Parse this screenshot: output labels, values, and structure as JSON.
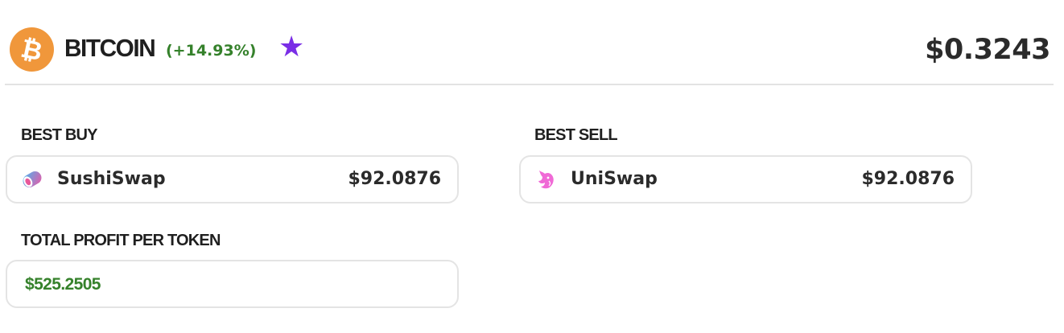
{
  "coin": {
    "icon": "bitcoin-icon",
    "symbol_glyph": "₿",
    "name": "BITCOIN",
    "change": "(+14.93%)",
    "favorite_icon": "star-icon",
    "price": "$0.3243"
  },
  "best_buy": {
    "label": "BEST BUY",
    "exchange": "SushiSwap",
    "exchange_icon": "sushiswap-icon",
    "price": "$92.0876"
  },
  "best_sell": {
    "label": "BEST SELL",
    "exchange": "UniSwap",
    "exchange_icon": "uniswap-icon",
    "price": "$92.0876"
  },
  "profit": {
    "label": "TOTAL PROFIT PER TOKEN",
    "value": "$525.2505"
  },
  "colors": {
    "bitcoin_orange": "#f0973b",
    "positive_green": "#35812b",
    "star_purple": "#7a2ee6",
    "border_gray": "#e4e4e4",
    "uniswap_pink": "#f06ad6"
  }
}
